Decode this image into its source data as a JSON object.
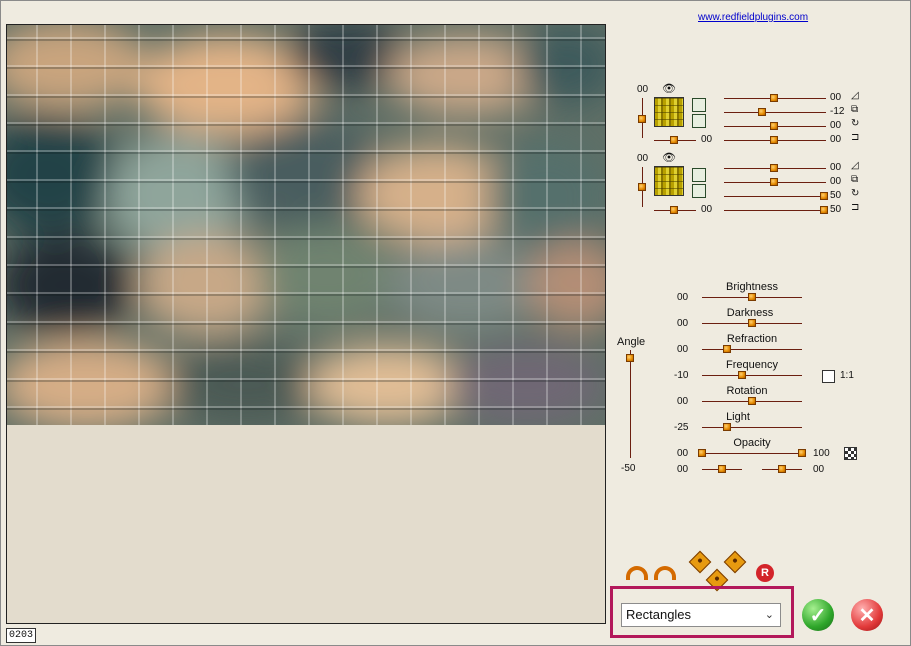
{
  "link": "www.redfieldplugins.com",
  "counter": "0203",
  "layer1": {
    "left_value": "00",
    "bottom_value": "00",
    "values": [
      "00",
      "-12",
      "00",
      "00"
    ]
  },
  "layer2": {
    "left_value": "00",
    "bottom_value": "00",
    "values": [
      "00",
      "00",
      "50",
      "50"
    ]
  },
  "angle": {
    "label": "Angle",
    "value": "-50"
  },
  "sliders": [
    {
      "label": "Brightness",
      "value": "00"
    },
    {
      "label": "Darkness",
      "value": "00"
    },
    {
      "label": "Refraction",
      "value": "00"
    },
    {
      "label": "Frequency",
      "value": "-10"
    },
    {
      "label": "Rotation",
      "value": "00"
    },
    {
      "label": "Light",
      "value": "-25"
    },
    {
      "label": "Opacity",
      "value": "00"
    }
  ],
  "opacity_right": "100",
  "ratio_label": "1:1",
  "extra_row": {
    "left": "00",
    "right": "00"
  },
  "preset": {
    "selected": "Rectangles"
  },
  "reset_label": "R"
}
